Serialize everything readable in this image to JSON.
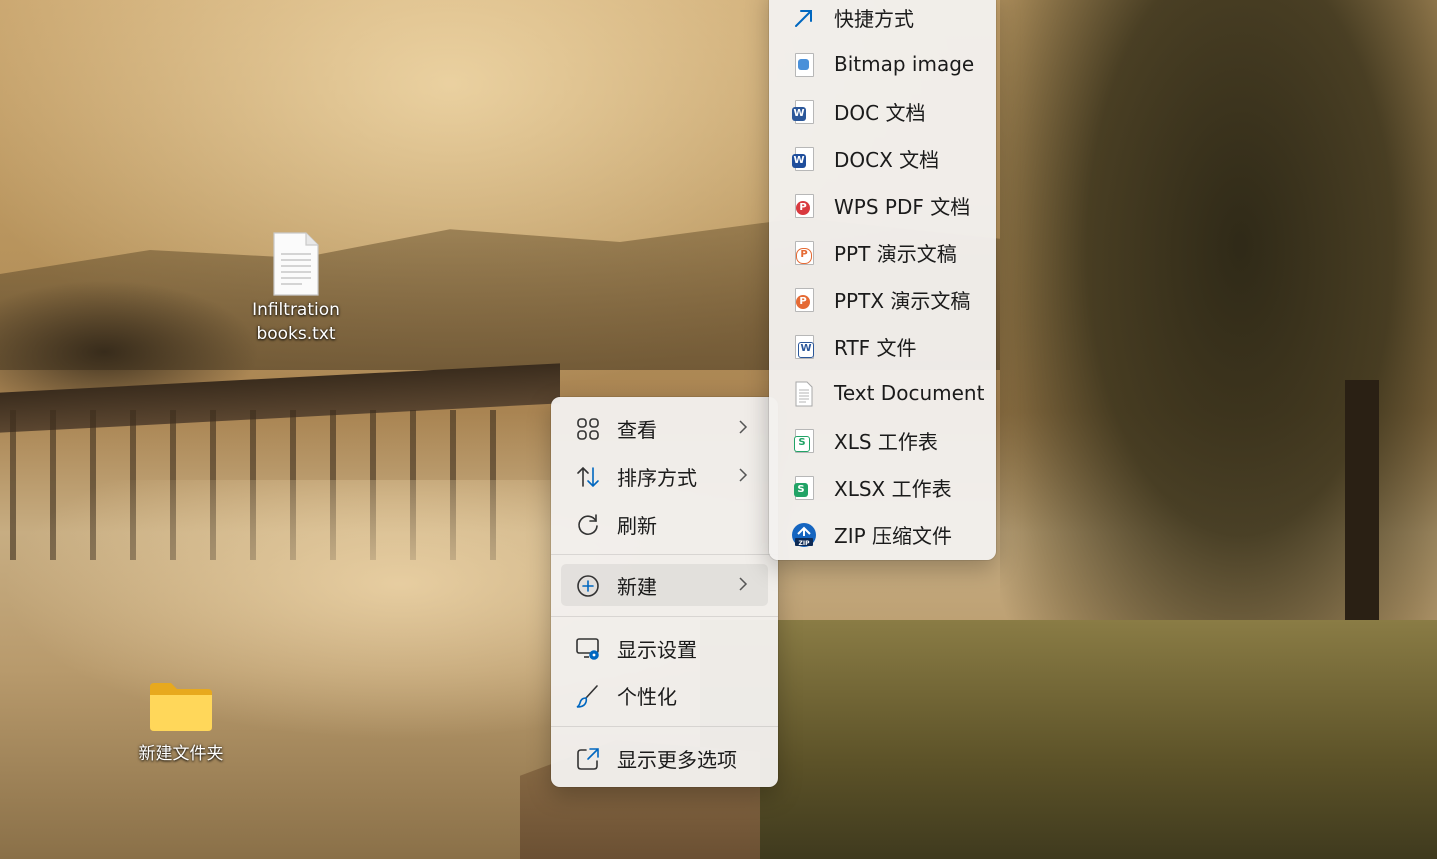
{
  "desktop": {
    "icons": [
      {
        "label_line1": "Infiltration",
        "label_line2": "books.txt",
        "icon": "text-file-icon"
      },
      {
        "label_line1": "新建文件夹",
        "icon": "folder-icon"
      }
    ]
  },
  "context_menu": {
    "items": [
      {
        "label": "查看",
        "icon": "view-grid-icon",
        "has_submenu": true
      },
      {
        "label": "排序方式",
        "icon": "sort-icon",
        "has_submenu": true
      },
      {
        "label": "刷新",
        "icon": "refresh-icon",
        "has_submenu": false
      },
      {
        "label": "新建",
        "icon": "new-plus-icon",
        "has_submenu": true,
        "highlighted": true
      },
      {
        "label": "显示设置",
        "icon": "display-settings-icon",
        "has_submenu": false
      },
      {
        "label": "个性化",
        "icon": "brush-icon",
        "has_submenu": false
      },
      {
        "label": "显示更多选项",
        "icon": "more-options-icon",
        "has_submenu": false
      }
    ]
  },
  "new_submenu": {
    "items": [
      {
        "label": "快捷方式",
        "icon": "shortcut-arrow-icon"
      },
      {
        "label": "Bitmap image",
        "icon": "bitmap-file-icon"
      },
      {
        "label": "DOC 文档",
        "icon": "doc-file-icon"
      },
      {
        "label": "DOCX 文档",
        "icon": "docx-file-icon"
      },
      {
        "label": "WPS PDF 文档",
        "icon": "pdf-file-icon"
      },
      {
        "label": "PPT 演示文稿",
        "icon": "ppt-file-icon"
      },
      {
        "label": "PPTX 演示文稿",
        "icon": "pptx-file-icon"
      },
      {
        "label": "RTF 文件",
        "icon": "rtf-file-icon"
      },
      {
        "label": "Text Document",
        "icon": "text-document-icon"
      },
      {
        "label": "XLS 工作表",
        "icon": "xls-file-icon"
      },
      {
        "label": "XLSX 工作表",
        "icon": "xlsx-file-icon"
      },
      {
        "label": "ZIP 压缩文件",
        "icon": "zip-file-icon"
      }
    ]
  },
  "colors": {
    "accent": "#0067c0",
    "word": "#2b579a",
    "pdf": "#d9393f",
    "ppt": "#e56a34",
    "excel": "#21a366",
    "zip": "#1565c0"
  }
}
